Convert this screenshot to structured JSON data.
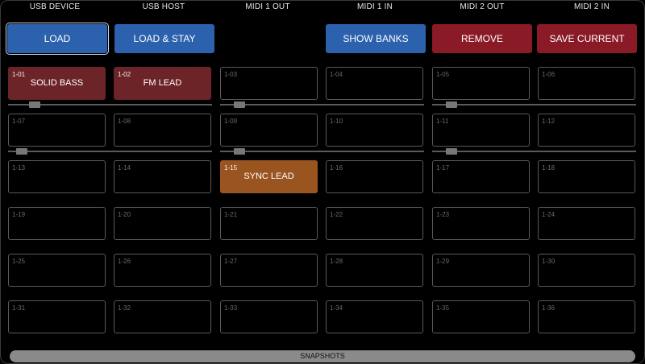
{
  "ports": [
    "USB DEVICE",
    "USB HOST",
    "MIDI 1 OUT",
    "MIDI 1 IN",
    "MIDI 2 OUT",
    "MIDI 2 IN"
  ],
  "buttons": {
    "load": "LOAD",
    "load_stay": "LOAD & STAY",
    "show_banks": "SHOW BANKS",
    "remove": "REMOVE",
    "save_current": "SAVE CURRENT"
  },
  "slots": [
    {
      "num": "1-01",
      "name": "SOLID BASS"
    },
    {
      "num": "1-02",
      "name": "FM LEAD"
    },
    {
      "num": "1-03",
      "name": ""
    },
    {
      "num": "1-04",
      "name": ""
    },
    {
      "num": "1-05",
      "name": ""
    },
    {
      "num": "1-06",
      "name": ""
    },
    {
      "num": "1-07",
      "name": ""
    },
    {
      "num": "1-08",
      "name": ""
    },
    {
      "num": "1-09",
      "name": ""
    },
    {
      "num": "1-10",
      "name": ""
    },
    {
      "num": "1-11",
      "name": ""
    },
    {
      "num": "1-12",
      "name": ""
    },
    {
      "num": "1-13",
      "name": ""
    },
    {
      "num": "1-14",
      "name": ""
    },
    {
      "num": "1-15",
      "name": "SYNC LEAD"
    },
    {
      "num": "1-16",
      "name": ""
    },
    {
      "num": "1-17",
      "name": ""
    },
    {
      "num": "1-18",
      "name": ""
    },
    {
      "num": "1-19",
      "name": ""
    },
    {
      "num": "1-20",
      "name": ""
    },
    {
      "num": "1-21",
      "name": ""
    },
    {
      "num": "1-22",
      "name": ""
    },
    {
      "num": "1-23",
      "name": ""
    },
    {
      "num": "1-24",
      "name": ""
    },
    {
      "num": "1-25",
      "name": ""
    },
    {
      "num": "1-26",
      "name": ""
    },
    {
      "num": "1-27",
      "name": ""
    },
    {
      "num": "1-28",
      "name": ""
    },
    {
      "num": "1-29",
      "name": ""
    },
    {
      "num": "1-30",
      "name": ""
    },
    {
      "num": "1-31",
      "name": ""
    },
    {
      "num": "1-32",
      "name": ""
    },
    {
      "num": "1-33",
      "name": ""
    },
    {
      "num": "1-34",
      "name": ""
    },
    {
      "num": "1-35",
      "name": ""
    },
    {
      "num": "1-36",
      "name": ""
    }
  ],
  "sliders": [
    {
      "value": 0.11
    },
    {
      "value": 0.07
    },
    {
      "value": 0.07
    },
    {
      "value": 0.04
    },
    {
      "value": 0.07
    },
    {
      "value": 0.07
    }
  ],
  "snapshots_label": "SNAPSHOTS",
  "colors": {
    "blue": "#2b61ad",
    "red": "#8a1a26",
    "slot_red": "#6c2428",
    "slot_orange": "#9a5420"
  }
}
